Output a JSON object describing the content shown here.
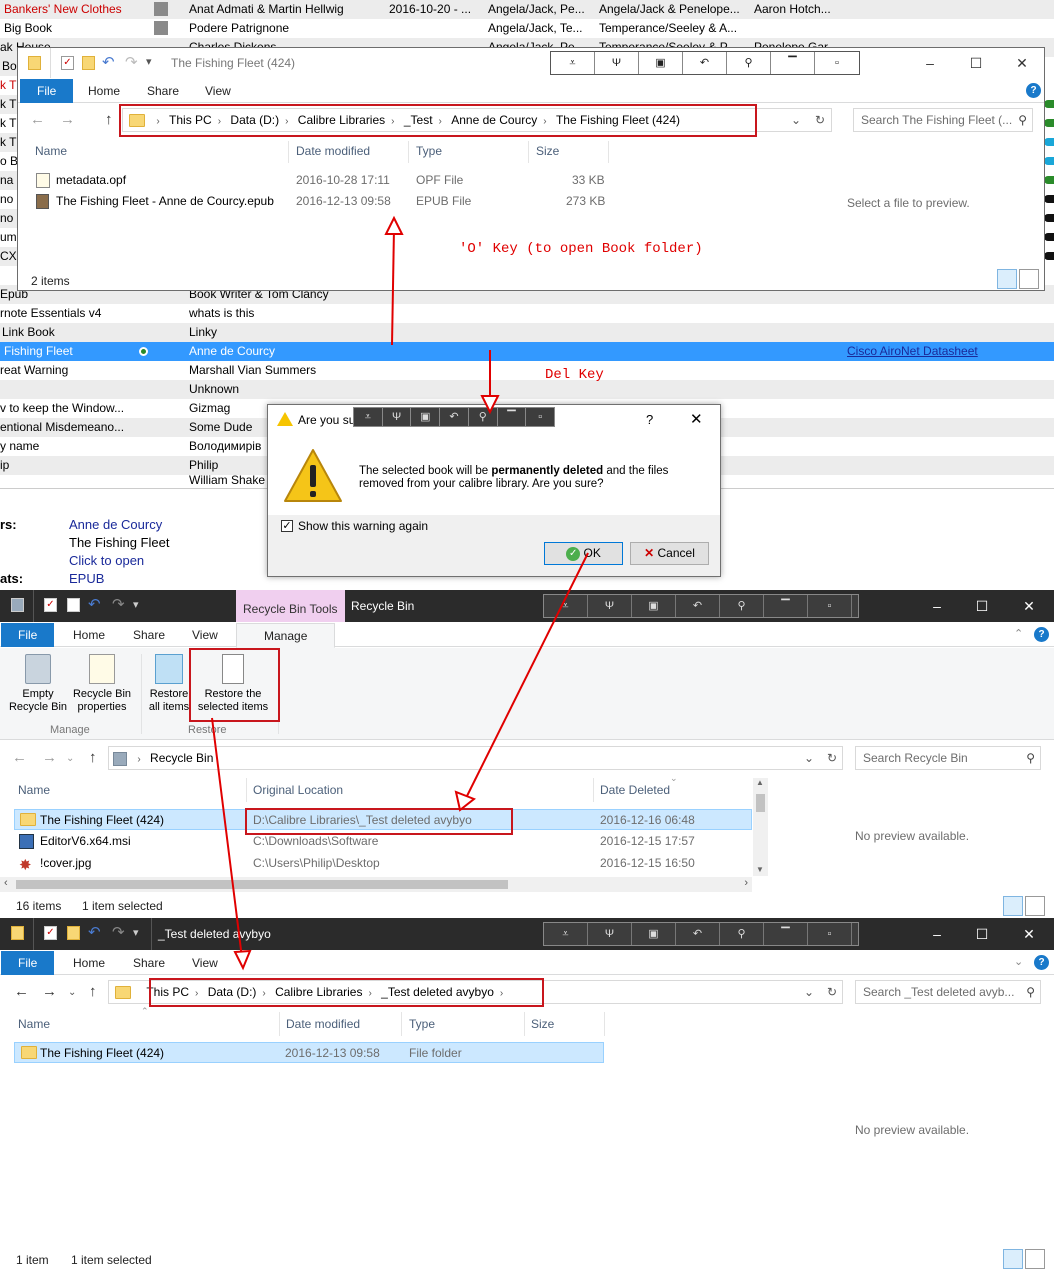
{
  "calibre": {
    "top_rows": [
      {
        "title": "Bankers' New Clothes",
        "author": "Anat Admati & Martin Hellwig",
        "date": "2016-10-20 - ...",
        "c1": "Angela/Jack, Pe...",
        "c2": "Angela/Jack & Penelope...",
        "c3": "Aaron Hotch..."
      },
      {
        "title": "Big Book",
        "author": "Podere Patrignone",
        "date": "",
        "c1": "Angela/Jack, Te...",
        "c2": "Temperance/Seeley & A...",
        "c3": ""
      },
      {
        "title": "ak House",
        "author": "Charles Dickens",
        "date": "",
        "c1": "Angela/Jack, Pe...",
        "c2": "Temperance/Seeley & P...",
        "c3": "Penelope Gar..."
      }
    ],
    "left_stubs": [
      "Bo",
      "k T",
      "k T",
      "k T",
      "k T",
      "o Ba",
      "na",
      "no",
      "no",
      "um",
      "CX"
    ],
    "mid_rows": [
      {
        "title": "Epub",
        "author": "Book Writer & Tom Clancy"
      },
      {
        "title": "rnote Essentials v4",
        "author": "whats is this"
      },
      {
        "title": "Link Book",
        "author": "Linky"
      },
      {
        "title": "Fishing Fleet",
        "author": "Anne de Courcy",
        "extra": "Cisco AiroNet Datasheet"
      },
      {
        "title": "reat Warning",
        "author": "Marshall Vian Summers"
      },
      {
        "title": "",
        "author": "Unknown"
      },
      {
        "title": "v to keep the Window...",
        "author": "Gizmag"
      },
      {
        "title": "entional Misdemeano...",
        "author": "Some Dude"
      },
      {
        "title": "y name",
        "author": "Володимирів"
      },
      {
        "title": "ip",
        "author": "Philip"
      },
      {
        "title": "",
        "author": "William Shake"
      }
    ],
    "details": {
      "authors_label": "rs:",
      "author": "Anne de Courcy",
      "title": "The Fishing Fleet",
      "open": "Click to open",
      "formats_label": "ats:",
      "format": "EPUB"
    }
  },
  "win1": {
    "title": "The Fishing Fleet (424)",
    "tabs": [
      "File",
      "Home",
      "Share",
      "View"
    ],
    "breadcrumbs": [
      "This PC",
      "Data (D:)",
      "Calibre Libraries",
      "_Test",
      "Anne de Courcy",
      "The Fishing Fleet (424)"
    ],
    "search_placeholder": "Search The Fishing Fleet (...",
    "columns": [
      "Name",
      "Date modified",
      "Type",
      "Size"
    ],
    "files": [
      {
        "name": "metadata.opf",
        "date": "2016-10-28 17:11",
        "type": "OPF File",
        "size": "33 KB"
      },
      {
        "name": "The Fishing Fleet - Anne de Courcy.epub",
        "date": "2016-12-13 09:58",
        "type": "EPUB File",
        "size": "273 KB"
      }
    ],
    "preview": "Select a file to preview.",
    "status": "2 items"
  },
  "annotations": {
    "o_key": "'O' Key (to open Book folder)",
    "del_key": "Del Key"
  },
  "dialog": {
    "title": "Are you sure?",
    "message_pre": "The selected book will be ",
    "message_bold": "permanently deleted",
    "message_post": " and the files removed from your calibre library. Are you sure?",
    "checkbox": "Show this warning again",
    "ok": "OK",
    "cancel": "Cancel",
    "help": "?"
  },
  "win2": {
    "tools_tab": "Recycle Bin Tools",
    "title": "Recycle Bin",
    "tabs": [
      "File",
      "Home",
      "Share",
      "View",
      "Manage"
    ],
    "ribbon": {
      "empty": [
        "Empty",
        "Recycle Bin"
      ],
      "props": [
        "Recycle Bin",
        "properties"
      ],
      "restore_all": [
        "Restore",
        "all items"
      ],
      "restore_sel": [
        "Restore the",
        "selected items"
      ],
      "group_manage": "Manage",
      "group_restore": "Restore"
    },
    "breadcrumbs": [
      "Recycle Bin"
    ],
    "search_placeholder": "Search Recycle Bin",
    "columns": [
      "Name",
      "Original Location",
      "Date Deleted"
    ],
    "files": [
      {
        "name": "The Fishing Fleet (424)",
        "location": "D:\\Calibre Libraries\\_Test deleted avybyo",
        "date": "2016-12-16 06:48"
      },
      {
        "name": "EditorV6.x64.msi",
        "location": "C:\\Downloads\\Software",
        "date": "2016-12-15 17:57"
      },
      {
        "name": "!cover.jpg",
        "location": "C:\\Users\\Philip\\Desktop",
        "date": "2016-12-15 16:50"
      }
    ],
    "preview": "No preview available.",
    "status_items": "16 items",
    "status_selected": "1 item selected"
  },
  "win3": {
    "title": "_Test deleted avybyo",
    "tabs": [
      "File",
      "Home",
      "Share",
      "View"
    ],
    "breadcrumbs": [
      "This PC",
      "Data (D:)",
      "Calibre Libraries",
      "_Test deleted avybyo"
    ],
    "search_placeholder": "Search _Test deleted avyb...",
    "columns": [
      "Name",
      "Date modified",
      "Type",
      "Size"
    ],
    "files": [
      {
        "name": "The Fishing Fleet (424)",
        "date": "2016-12-13 09:58",
        "type": "File folder"
      }
    ],
    "preview": "No preview available.",
    "status_items": "1 item",
    "status_selected": "1 item selected"
  },
  "toolbar_icons": [
    "down-arrow-icon",
    "pin-icon",
    "window-icon",
    "undo-icon",
    "push-pin-icon",
    "minimize-bar-icon",
    "dot-icon"
  ],
  "colors": {
    "accent": "#1979ca",
    "select": "#3399ff",
    "annotation": "#c8161d",
    "tools_tab": "#f0cfef"
  }
}
